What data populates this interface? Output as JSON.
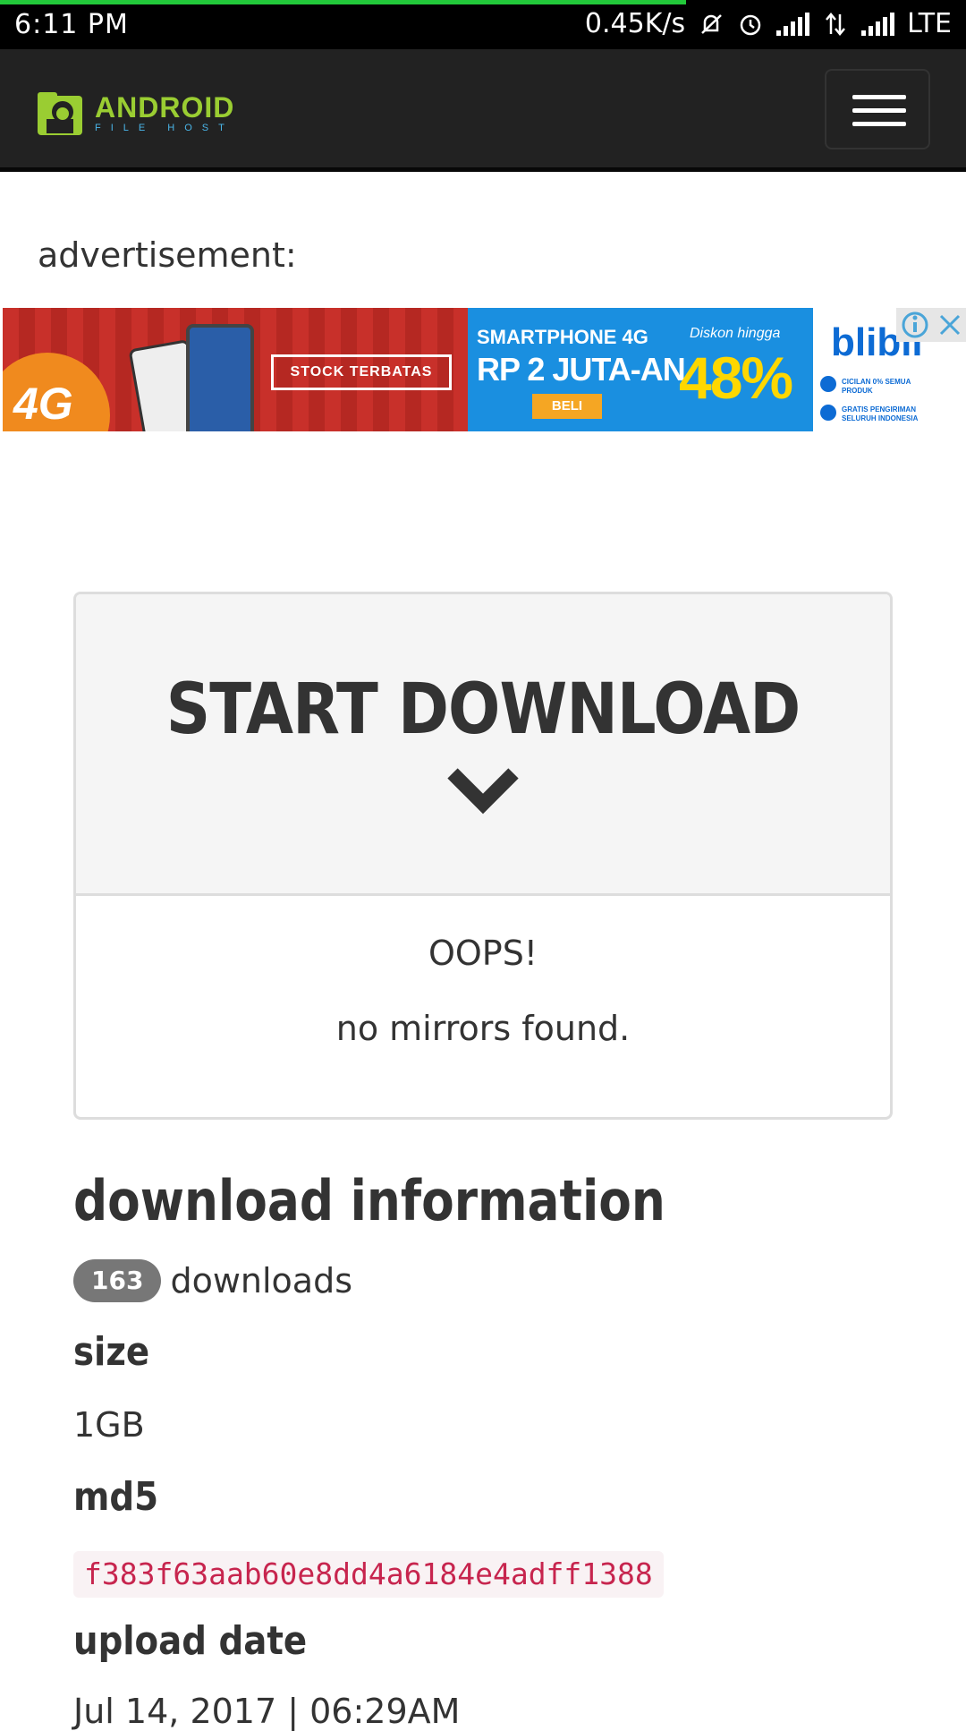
{
  "status_bar": {
    "time": "6:11 PM",
    "net_speed": "0.45K/s",
    "network": "LTE",
    "icons": [
      "mute-icon",
      "alarm-icon",
      "signal-icon",
      "data-transfer-icon",
      "signal-icon"
    ],
    "page_load_progress": 0.71
  },
  "header": {
    "logo_title": "ANDROID",
    "logo_subtitle": "FILE HOST",
    "menu_icon": "hamburger-menu-icon"
  },
  "advertisement_label": "advertisement:",
  "ad": {
    "badge_4g": "4G",
    "stock": "STOCK TERBATAS",
    "headline": "SMARTPHONE 4G",
    "price": "RP 2 JUTA-AN",
    "cta": "BELI",
    "discount_label": "Diskon hingga",
    "discount": "48%",
    "brand": "blibli",
    "perk1": "CICILAN 0% SEMUA PRODUK",
    "perk2": "GRATIS PENGIRIMAN SELURUH INDONESIA",
    "close_icon": "close-icon",
    "info_icon": "info-icon"
  },
  "download": {
    "button_label": "START DOWNLOAD",
    "chevron_icon": "chevron-down-icon",
    "error_title": "OOPS!",
    "error_message": "no mirrors found."
  },
  "info": {
    "title": "download information",
    "download_count": "163",
    "downloads_label": "downloads",
    "size_label": "size",
    "size_value": "1GB",
    "md5_label": "md5",
    "md5_value": "f383f63aab60e8dd4a6184e4adff1388",
    "upload_label": "upload date",
    "upload_value": "Jul 14, 2017 | 06:29AM"
  }
}
